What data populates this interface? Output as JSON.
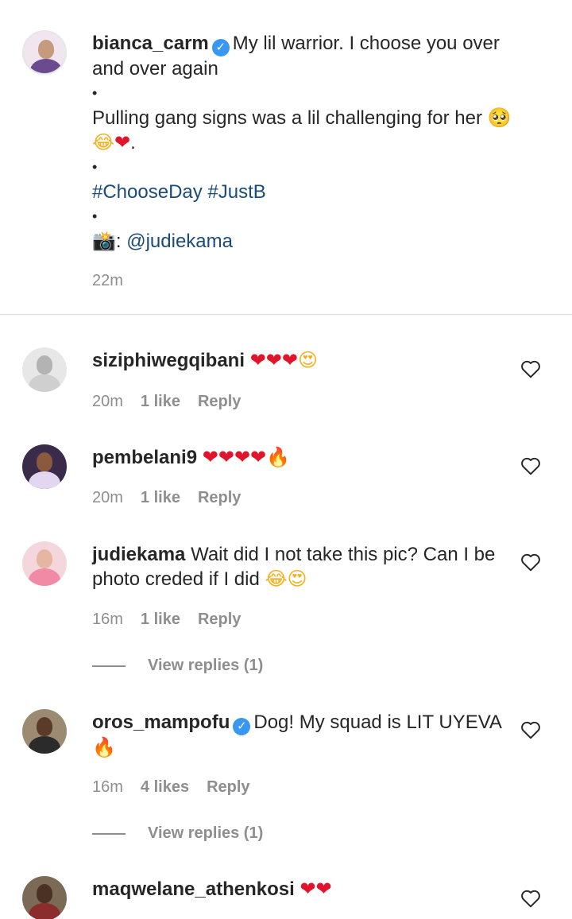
{
  "caption": {
    "username": "bianca_carm",
    "line1": "My lil warrior. I choose you over and over again",
    "bullet": "•",
    "line2": "Pulling gang signs was a lil challenging for her",
    "line2_end": ".",
    "hashtag1": "#ChooseDay",
    "hashtag2": "#JustB",
    "camera": "📸",
    "credit_prefix": ":",
    "credit_mention": "@judiekama",
    "time": "22m"
  },
  "emoji": {
    "heart": "❤",
    "fire": "🔥",
    "heart_eyes": "😍",
    "laugh": "😂",
    "pleading": "🥺"
  },
  "comments": [
    {
      "username": "siziphiwegqibani",
      "time": "20m",
      "likes": "1 like",
      "reply": "Reply"
    },
    {
      "username": "pembelani9",
      "time": "20m",
      "likes": "1 like",
      "reply": "Reply"
    },
    {
      "username": "judiekama",
      "text": "Wait did I not take this pic? Can I be photo creded if I did",
      "time": "16m",
      "likes": "1 like",
      "reply": "Reply",
      "view_replies": "View replies (1)"
    },
    {
      "username": "oros_mampofu",
      "text": "Dog! My squad is LIT UYEVA",
      "time": "16m",
      "likes": "4 likes",
      "reply": "Reply",
      "view_replies": "View replies (1)"
    },
    {
      "username": "maqwelane_athenkosi"
    }
  ],
  "icons": {
    "verified": "✓",
    "like": "heart-outline-icon"
  },
  "colors": {
    "verified_blue": "#3897f0",
    "link_blue": "#1a4b7a",
    "meta_gray": "#8e8e8e",
    "text": "#262626"
  }
}
